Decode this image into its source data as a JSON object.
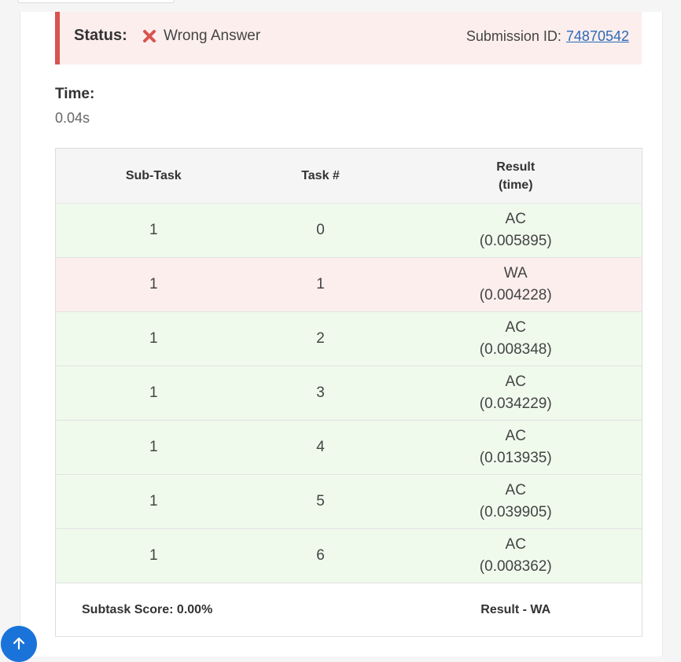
{
  "status": {
    "label": "Status:",
    "value": "Wrong Answer",
    "submission_label": "Submission ID:",
    "submission_id": "74870542"
  },
  "time": {
    "label": "Time:",
    "value": "0.04s"
  },
  "table": {
    "headers": [
      "Sub-Task",
      "Task #",
      "Result",
      "(time)"
    ],
    "rows": [
      {
        "subtask": "1",
        "task": "0",
        "result": "AC",
        "time": "(0.005895)"
      },
      {
        "subtask": "1",
        "task": "1",
        "result": "WA",
        "time": "(0.004228)"
      },
      {
        "subtask": "1",
        "task": "2",
        "result": "AC",
        "time": "(0.008348)"
      },
      {
        "subtask": "1",
        "task": "3",
        "result": "AC",
        "time": "(0.034229)"
      },
      {
        "subtask": "1",
        "task": "4",
        "result": "AC",
        "time": "(0.013935)"
      },
      {
        "subtask": "1",
        "task": "5",
        "result": "AC",
        "time": "(0.039905)"
      },
      {
        "subtask": "1",
        "task": "6",
        "result": "AC",
        "time": "(0.008362)"
      }
    ],
    "summary": {
      "score": "Subtask Score: 0.00%",
      "result": "Result - WA"
    }
  },
  "icons": {
    "status": "close-icon",
    "fab": "arrow-up-icon"
  },
  "colors": {
    "error": "#d9534f",
    "ac_row": "#effaec",
    "wa_row": "#fdeeee",
    "link": "#2a6ab5",
    "fab": "#1a73d9"
  }
}
